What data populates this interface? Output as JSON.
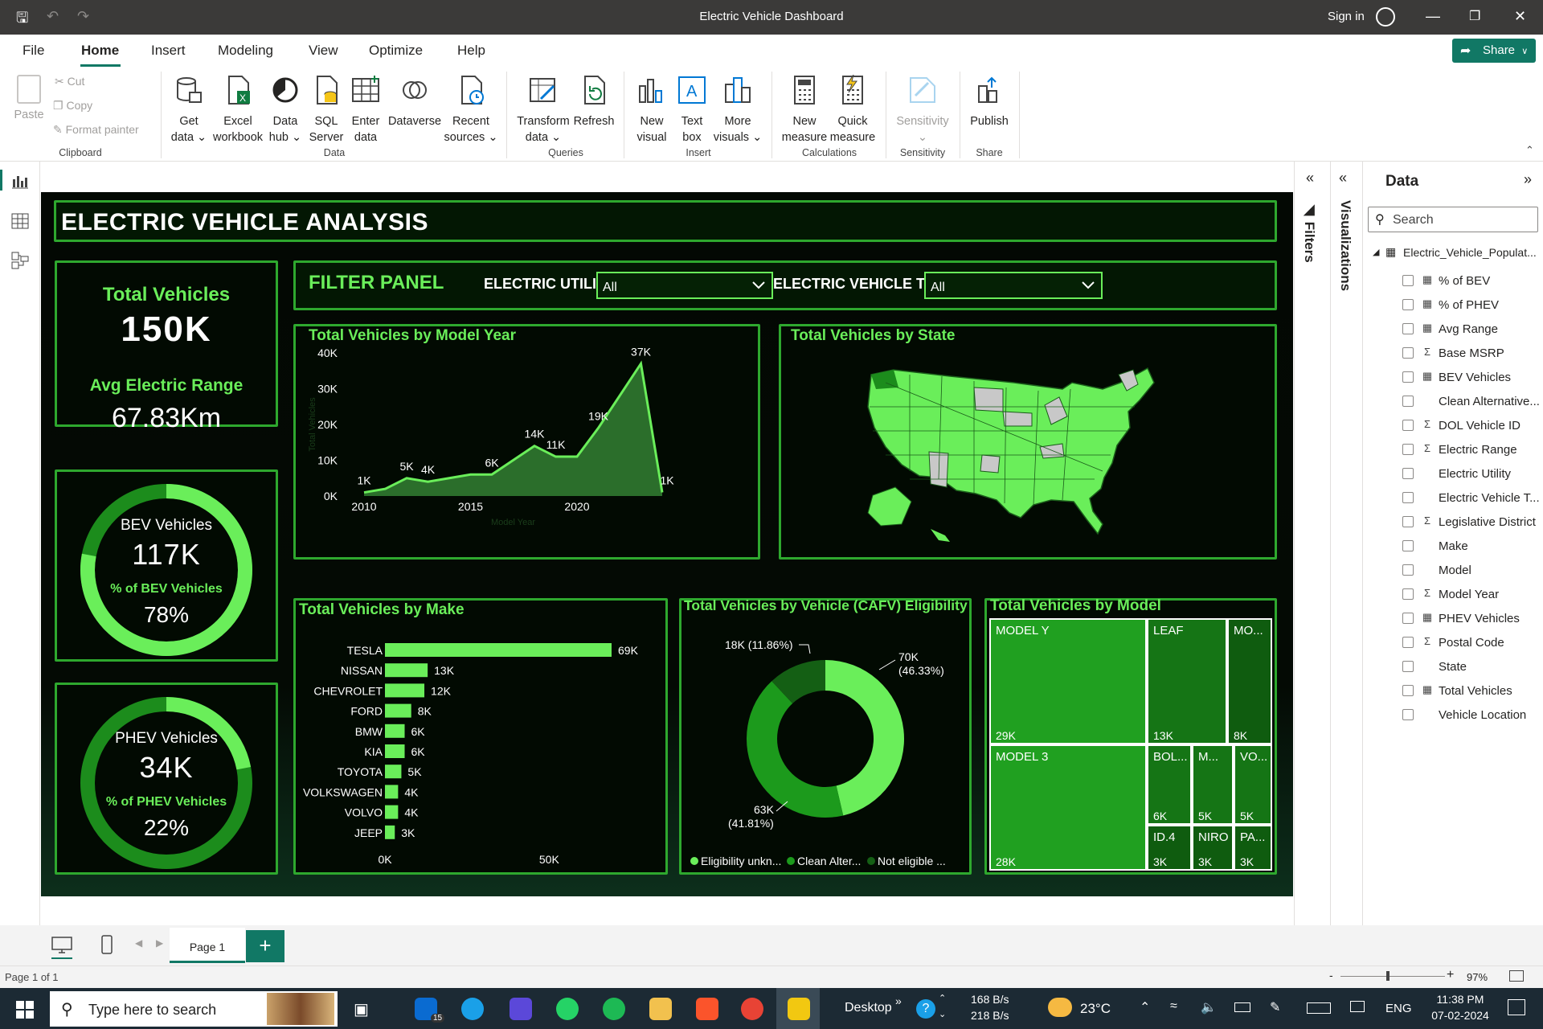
{
  "window": {
    "title": "Electric Vehicle Dashboard",
    "sign_in": "Sign in"
  },
  "menu": [
    "File",
    "Home",
    "Insert",
    "Modeling",
    "View",
    "Optimize",
    "Help"
  ],
  "share_label": "Share",
  "ribbon": {
    "clipboard": {
      "paste": "Paste",
      "cut": "Cut",
      "copy": "Copy",
      "format_painter": "Format painter",
      "group": "Clipboard"
    },
    "data": {
      "get_data": [
        "Get",
        "data"
      ],
      "excel": [
        "Excel",
        "workbook"
      ],
      "data_hub": [
        "Data",
        "hub"
      ],
      "sql": [
        "SQL",
        "Server"
      ],
      "enter": [
        "Enter",
        "data"
      ],
      "dataverse": "Dataverse",
      "recent": [
        "Recent",
        "sources"
      ],
      "group": "Data"
    },
    "queries": {
      "transform": [
        "Transform",
        "data"
      ],
      "refresh": "Refresh",
      "group": "Queries"
    },
    "insert": {
      "new_visual": [
        "New",
        "visual"
      ],
      "text_box": [
        "Text",
        "box"
      ],
      "more_visuals": [
        "More",
        "visuals"
      ],
      "group": "Insert"
    },
    "calculations": {
      "new_measure": [
        "New",
        "measure"
      ],
      "quick_measure": [
        "Quick",
        "measure"
      ],
      "group": "Calculations"
    },
    "sensitivity": {
      "label": "Sensitivity",
      "group": "Sensitivity"
    },
    "share": {
      "publish": "Publish",
      "group": "Share"
    }
  },
  "report": {
    "title": "ELECTRIC VEHICLE ANALYSIS",
    "kpi_total": {
      "label": "Total Vehicles",
      "value": "150K",
      "range_label": "Avg Electric Range",
      "range_value": "67.83Km"
    },
    "bev": {
      "label": "BEV Vehicles",
      "value": "117K",
      "pct_label": "% of BEV Vehicles",
      "pct_value": "78%",
      "pct": 0.78
    },
    "phev": {
      "label": "PHEV Vehicles",
      "value": "34K",
      "pct_label": "% of PHEV Vehicles",
      "pct_value": "22%",
      "pct": 0.22
    },
    "filter_panel": {
      "title": "FILTER PANEL",
      "utility_label": "ELECTRIC UTILITY",
      "utility_value": "All",
      "type_label": "ELECTRIC VEHICLE TYPE",
      "type_value": "All"
    },
    "state_map_title": "Total Vehicles by State",
    "treemap_title": "Total Vehicles by Model"
  },
  "chart_data": [
    {
      "type": "area",
      "title": "Total Vehicles by Model Year",
      "xlabel": "Model Year",
      "ylabel": "Total Vehicles",
      "x": [
        2010,
        2011,
        2012,
        2013,
        2014,
        2015,
        2016,
        2017,
        2018,
        2019,
        2020,
        2021,
        2022,
        2023,
        2024
      ],
      "values": [
        1000,
        2000,
        5000,
        4000,
        5000,
        6000,
        6000,
        10000,
        14000,
        11000,
        11000,
        19000,
        28000,
        37000,
        1000
      ],
      "data_labels": {
        "2010": "1K",
        "2012": "5K",
        "2013": "4K",
        "2016": "6K",
        "2018": "14K",
        "2019": "11K",
        "2021": "19K",
        "2023": "37K",
        "2024": "1K"
      },
      "yticks": [
        "0K",
        "10K",
        "20K",
        "30K",
        "40K"
      ],
      "xticks": [
        "2010",
        "2015",
        "2020"
      ],
      "ylim": [
        0,
        40000
      ],
      "color": "#6aee5a"
    },
    {
      "type": "bar",
      "title": "Total Vehicles by Make",
      "orientation": "horizontal",
      "categories": [
        "TESLA",
        "NISSAN",
        "CHEVROLET",
        "FORD",
        "BMW",
        "KIA",
        "TOYOTA",
        "VOLKSWAGEN",
        "VOLVO",
        "JEEP"
      ],
      "values": [
        69000,
        13000,
        12000,
        8000,
        6000,
        6000,
        5000,
        4000,
        4000,
        3000
      ],
      "labels": [
        "69K",
        "13K",
        "12K",
        "8K",
        "6K",
        "6K",
        "5K",
        "4K",
        "4K",
        "3K"
      ],
      "xticks": [
        "0K",
        "50K"
      ],
      "xlim": [
        0,
        69000
      ],
      "color": "#6aee5a"
    },
    {
      "type": "pie",
      "title": "Total Vehicles by Vehicle (CAFV) Eligibility",
      "donut": true,
      "slices": [
        {
          "name": "Eligibility unkn...",
          "value": 70000,
          "label": "70K",
          "pct": "(46.33%)",
          "color": "#6aee5a"
        },
        {
          "name": "Clean Alter...",
          "value": 63000,
          "label": "63K",
          "pct": "(41.81%)",
          "color": "#1c9a1c"
        },
        {
          "name": "Not eligible ...",
          "value": 18000,
          "label": "18K (11.86%)",
          "color": "#145f14"
        }
      ]
    },
    {
      "type": "treemap",
      "title": "Total Vehicles by Model",
      "items": [
        {
          "name": "MODEL Y",
          "label": "29K"
        },
        {
          "name": "MODEL 3",
          "label": "28K"
        },
        {
          "name": "LEAF",
          "label": "13K"
        },
        {
          "name": "MO...",
          "label": "8K"
        },
        {
          "name": "BOL...",
          "label": "6K"
        },
        {
          "name": "M...",
          "label": "5K"
        },
        {
          "name": "VO...",
          "label": "5K"
        },
        {
          "name": "ID.4",
          "label": "3K"
        },
        {
          "name": "NIRO",
          "label": "3K"
        },
        {
          "name": "PA...",
          "label": "3K"
        }
      ]
    }
  ],
  "panes": {
    "filters": "Filters",
    "visualizations": "Visualizations",
    "data_title": "Data",
    "search_placeholder": "Search",
    "table": "Electric_Vehicle_Populat...",
    "fields": [
      {
        "name": "% of BEV",
        "type": "calc"
      },
      {
        "name": "% of PHEV",
        "type": "calc"
      },
      {
        "name": "Avg Range",
        "type": "calc"
      },
      {
        "name": "Base MSRP",
        "type": "sum"
      },
      {
        "name": "BEV Vehicles",
        "type": "calc"
      },
      {
        "name": "Clean Alternative...",
        "type": "none"
      },
      {
        "name": "DOL Vehicle ID",
        "type": "sum"
      },
      {
        "name": "Electric Range",
        "type": "sum"
      },
      {
        "name": "Electric Utility",
        "type": "none"
      },
      {
        "name": "Electric Vehicle T...",
        "type": "none"
      },
      {
        "name": "Legislative District",
        "type": "sum"
      },
      {
        "name": "Make",
        "type": "none"
      },
      {
        "name": "Model",
        "type": "none"
      },
      {
        "name": "Model Year",
        "type": "sum"
      },
      {
        "name": "PHEV Vehicles",
        "type": "calc"
      },
      {
        "name": "Postal Code",
        "type": "sum"
      },
      {
        "name": "State",
        "type": "none"
      },
      {
        "name": "Total Vehicles",
        "type": "calc"
      },
      {
        "name": "Vehicle Location",
        "type": "none"
      }
    ]
  },
  "pages": {
    "tab": "Page 1",
    "status": "Page 1 of 1",
    "zoom": "97%"
  },
  "taskbar": {
    "search": "Type here to search",
    "desktop": "Desktop",
    "net_up": "168 B/s",
    "net_down": "218 B/s",
    "weather": "23°C",
    "lang": "ENG",
    "time": "11:38 PM",
    "date": "07-02-2024",
    "mail_badge": "15"
  }
}
